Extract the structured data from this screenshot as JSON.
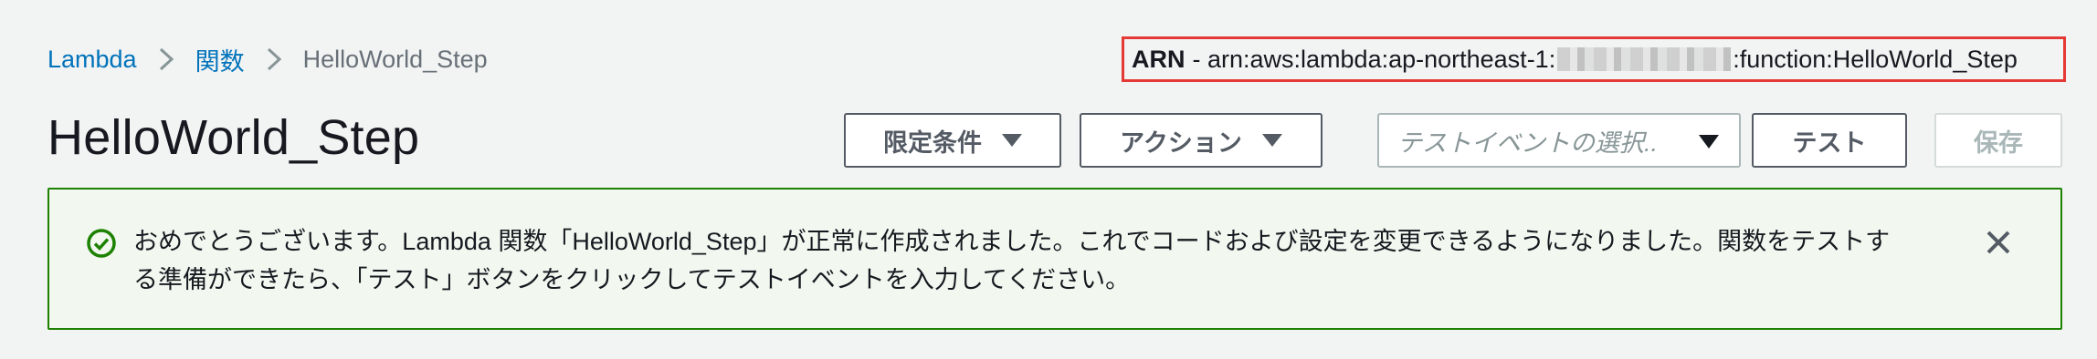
{
  "breadcrumb": {
    "items": [
      {
        "label": "Lambda"
      },
      {
        "label": "関数"
      },
      {
        "label": "HelloWorld_Step"
      }
    ]
  },
  "arn": {
    "label": "ARN",
    "prefix": "- arn:aws:lambda:ap-northeast-1:",
    "suffix": ":function:HelloWorld_Step"
  },
  "page": {
    "title": "HelloWorld_Step"
  },
  "toolbar": {
    "limit_label": "限定条件",
    "action_label": "アクション",
    "test_event_placeholder": "テストイベントの選択..",
    "test_label": "テスト",
    "save_label": "保存"
  },
  "alert": {
    "message_line1": "おめでとうございます。Lambda 関数「HelloWorld_Step」が正常に作成されました。これでコードおよび設定を変更できるようになりました。関数をテストす",
    "message_line2": "る準備ができたら、「テスト」ボタンをクリックしてテストイベントを入力してください。"
  },
  "colors": {
    "link": "#0073bb",
    "success": "#1d8102",
    "highlight": "#e53935"
  },
  "icons": {
    "breadcrumb_separator": "chevron-right-icon",
    "alert": "check-circle-icon",
    "close": "close-icon",
    "dropdown": "caret-down-icon"
  }
}
